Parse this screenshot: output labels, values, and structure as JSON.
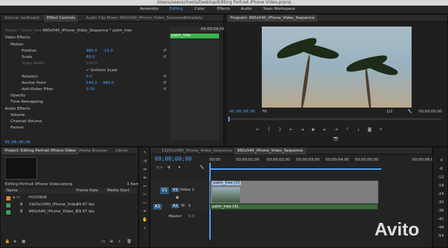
{
  "window": {
    "title": "/Users/seanschools/Desktop/Editing Portrait iPhone Video.prproj"
  },
  "workspaces": [
    "Assembly",
    "Editing",
    "Color",
    "Effects",
    "Audio",
    "Sean Workspace"
  ],
  "effect_controls": {
    "tabs": [
      "Source: surfboard",
      "Effect Controls",
      "Audio Clip Mixer: 960x540_iPhone_Video_Sequence",
      "Metadata"
    ],
    "master": "Master * palm_tree",
    "sequence": "960x540_iPhone_Video_Sequence * palm_tree",
    "mini_clip": "palm_tree",
    "mini_time": "00;00;04;00",
    "video_effects": "Video Effects",
    "motion": "Motion",
    "position_label": "Position",
    "position_x": "480.0",
    "position_y": "-10.0",
    "scale_label": "Scale",
    "scale_value": "89.0",
    "scale_width_label": "Scale Width",
    "scale_width_value": "100.0",
    "uniform_scale": "Uniform Scale",
    "rotation_label": "Rotation",
    "rotation_value": "0.0",
    "anchor_label": "Anchor Point",
    "anchor_x": "540.0",
    "anchor_y": "960.0",
    "antiflicker_label": "Anti-flicker Filter",
    "antiflicker_value": "0.00",
    "opacity": "Opacity",
    "time_remapping": "Time Remapping",
    "audio_effects": "Audio Effects",
    "volume": "Volume",
    "channel_volume": "Channel Volume",
    "panner": "Panner",
    "timecode": "00;00;00;00"
  },
  "program": {
    "title": "Program: 960x540_iPhone_Video_Sequence",
    "timecode_left": "00;00;00;00",
    "fit": "Fit",
    "resolution": "1/2",
    "timecode_right": "00;00;05;00"
  },
  "project": {
    "tabs": [
      "Project: Editing Portrait iPhone Video",
      "Media Browser",
      "Librari"
    ],
    "file_name": "Editing Portrait iPhone Video.prproj",
    "items_count": "3 Items",
    "columns": [
      "Name",
      "Frame Rate",
      "Media Start"
    ],
    "rows": [
      {
        "name": "FOOTAGE",
        "rate": "",
        "color": "#e08a2a"
      },
      {
        "name": "1920x1080_iPhone_Video",
        "rate": "29.97 fps",
        "color": "#3ea35a"
      },
      {
        "name": "960x540_iPhone_Video_S",
        "rate": "29.97 fps",
        "color": "#3ea35a"
      }
    ]
  },
  "timeline": {
    "tabs": [
      "1920x1080_iPhone_Video_Sequence",
      "960x540_iPhone_Video_Sequence"
    ],
    "timecode": "00;00;00;00",
    "ruler": [
      "00;00",
      "00;00;01;00",
      "00;00;02;00",
      "00;00;03;00",
      "00;00;04;00",
      "00;00;05;00",
      "00;00;06;0"
    ],
    "v1_label": "V1",
    "v1_name": "Video 1",
    "a1_label": "A1",
    "a1_tag": "A1",
    "master_label": "Master",
    "master_value": "0.0",
    "video_clip": "palm_tree [V]",
    "audio_clip": "palm_tree [A]"
  },
  "meter": {
    "labels": [
      "0",
      "-6",
      "-12",
      "-18",
      "-24",
      "-30",
      "-36",
      "-42",
      "-48",
      "-54"
    ]
  },
  "watermark": "Avito"
}
